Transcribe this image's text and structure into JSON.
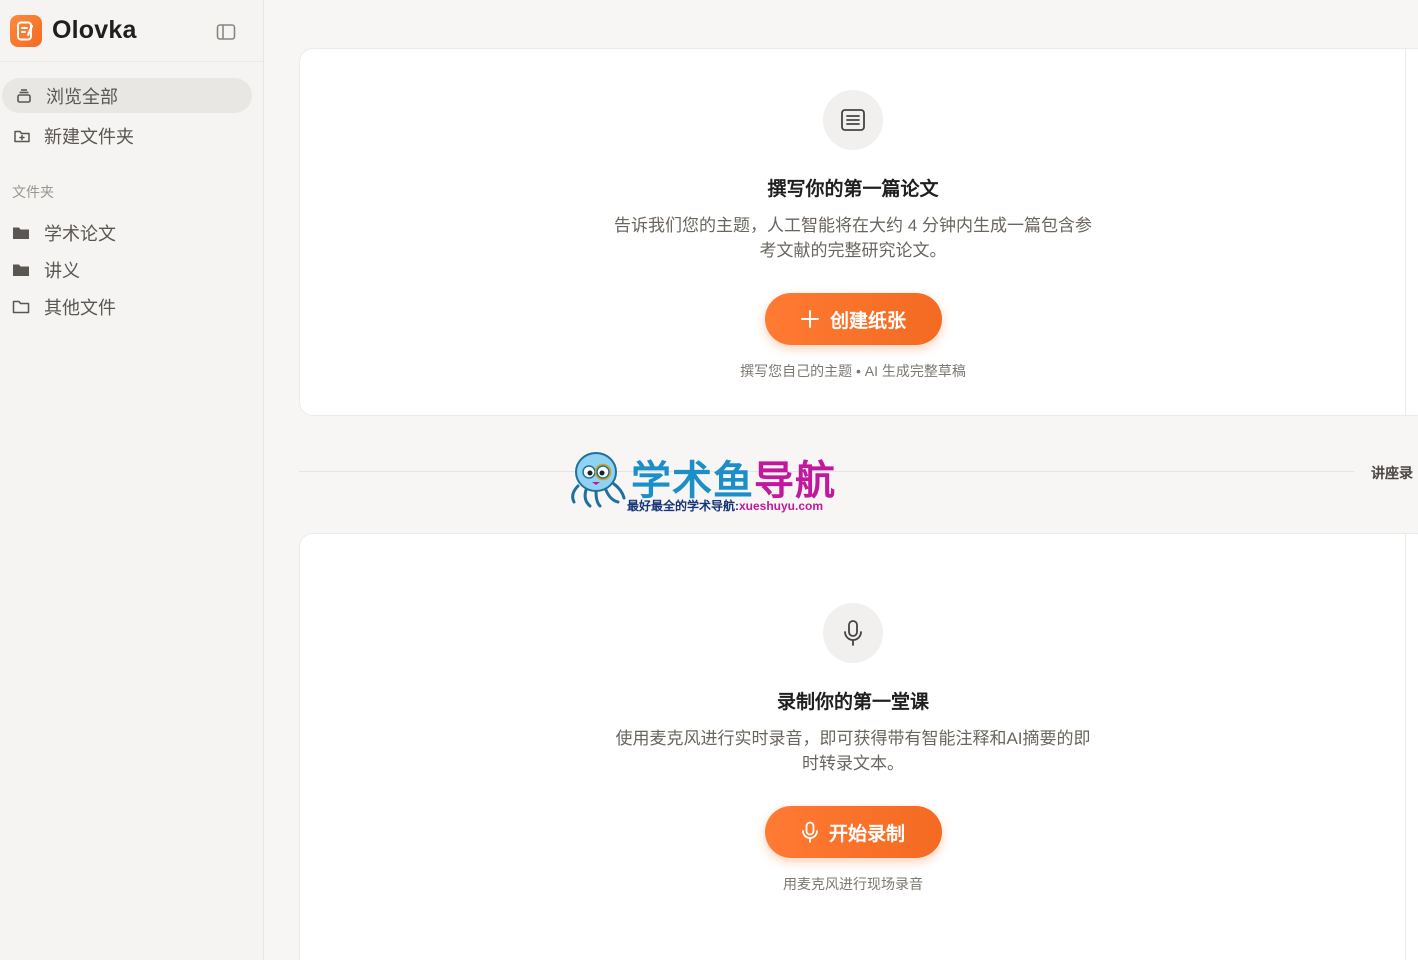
{
  "app": {
    "name": "Olovka",
    "logo_icon": "pen-note-icon",
    "accent": "#f46a22"
  },
  "sidebar": {
    "nav": [
      {
        "label": "浏览全部",
        "icon": "stack-icon",
        "active": true
      },
      {
        "label": "新建文件夹",
        "icon": "folder-plus-icon",
        "active": false
      }
    ],
    "section_label": "文件夹",
    "folders": [
      {
        "label": "学术论文",
        "icon": "folder-filled-icon"
      },
      {
        "label": "讲义",
        "icon": "folder-filled-icon"
      },
      {
        "label": "其他文件",
        "icon": "folder-outline-icon"
      }
    ]
  },
  "paper_card": {
    "icon": "document-icon",
    "title": "撰写你的第一篇论文",
    "description": "告诉我们您的主题，人工智能将在大约 4 分钟内生成一篇包含参考文献的完整研究论文。",
    "button_label": "创建纸张",
    "hint": "撰写您自己的主题 • AI 生成完整草稿"
  },
  "divider_label": "讲座录",
  "lecture_card": {
    "icon": "microphone-icon",
    "title": "录制你的第一堂课",
    "description": "使用麦克风进行实时录音，即可获得带有智能注释和AI摘要的即时转录文本。",
    "button_label": "开始录制",
    "hint": "用麦克风进行现场录音"
  },
  "watermark": {
    "title_a": "学术鱼",
    "title_b": "导航",
    "subtitle_a": "最好最全的学术导航:",
    "subtitle_b": "xueshuyu.com",
    "colors": {
      "blue": "#1c8fc9",
      "magenta": "#c2189e"
    }
  }
}
